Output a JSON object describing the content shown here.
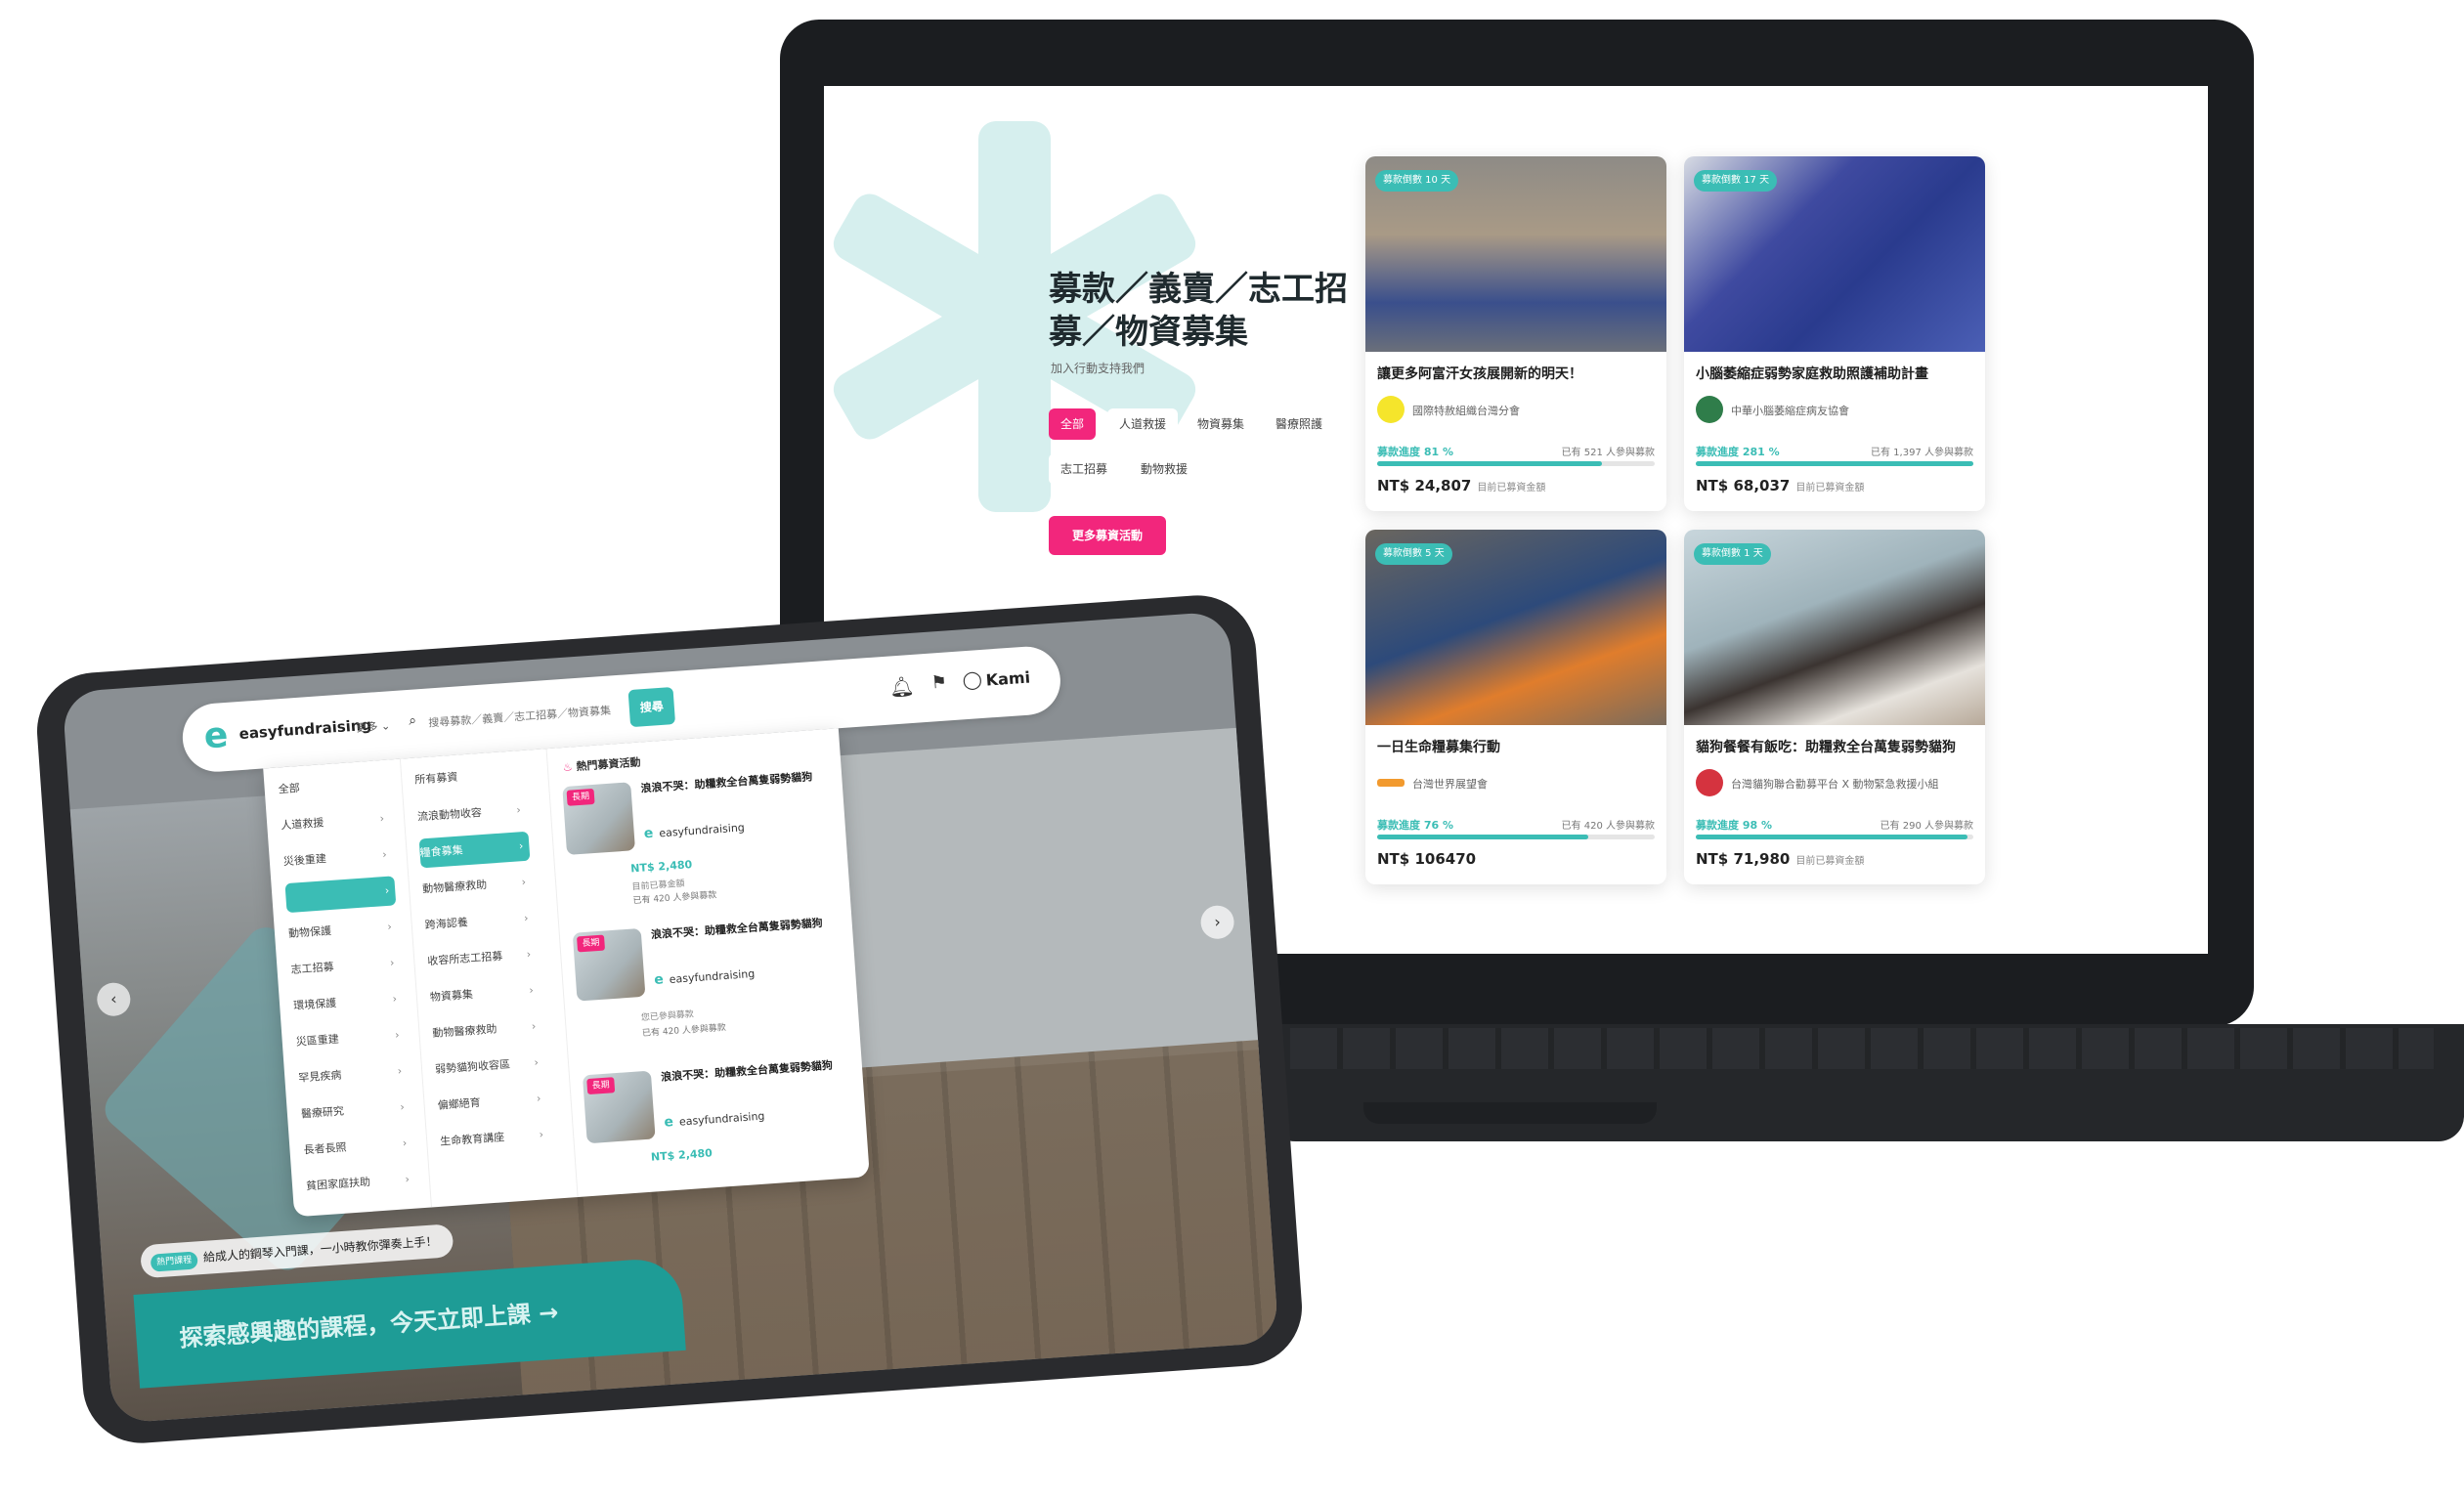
{
  "colors": {
    "teal": "#3bbdb5",
    "pink": "#f2267c"
  },
  "laptop": {
    "hero": {
      "title": "募款／義賣／志工招募／物資募集",
      "subtitle": "加入行動支持我們",
      "chips": [
        "全部",
        "人道救援",
        "物資募集",
        "醫療照護",
        "志工招募",
        "動物救援"
      ],
      "active_chip": "全部",
      "more_button": "更多募資活動"
    },
    "cards": [
      {
        "badge": "募款倒數 10 天",
        "title": "讓更多阿富汗女孩展開新的明天！",
        "org": "國際特赦組織台灣分會",
        "progress_label": "募款進度 81 %",
        "progress": 0.81,
        "count": "已有 521 人參與募款",
        "amount": "NT$ 24,807",
        "amount_label": "目前已募資金額"
      },
      {
        "badge": "募款倒數 17 天",
        "title": "小腦萎縮症弱勢家庭救助照護補助計畫",
        "org": "中華小腦萎縮症病友協會",
        "progress_label": "募款進度 281 %",
        "progress": 1.0,
        "count": "已有 1,397 人參與募款",
        "amount": "NT$ 68,037",
        "amount_label": "目前已募資金額"
      },
      {
        "badge": "募款倒數 5 天",
        "title": "一日生命糧募集行動",
        "org": "台灣世界展望會",
        "progress_label": "募款進度 76 %",
        "progress": 0.76,
        "count": "已有 420 人參與募款",
        "amount": "NT$ 106470",
        "amount_label": ""
      },
      {
        "badge": "募款倒數 1 天",
        "title": "貓狗餐餐有飯吃：助糧救全台萬隻弱勢貓狗",
        "org": "台灣貓狗聯合勸募平台 X 動物緊急救援小組",
        "progress_label": "募款進度 98 %",
        "progress": 0.98,
        "count": "已有 290 人參與募款",
        "amount": "NT$ 71,980",
        "amount_label": "目前已募資金額"
      }
    ]
  },
  "tablet": {
    "nav": {
      "logo": "easyfundraising",
      "more": "更多 ⌄",
      "search_placeholder": "搜尋募款／義賣／志工招募／物資募集",
      "search_button": "搜尋",
      "user": "Kami"
    },
    "mega": {
      "col1": [
        "全部",
        "人道救援",
        "災後重建",
        "",
        "動物保護",
        "志工招募",
        "環境保護",
        "災區重建",
        "罕見疾病",
        "醫療研究",
        "長者長照",
        "貧困家庭扶助"
      ],
      "col1_selected": 3,
      "col2_title": "所有募資",
      "col2": [
        "流浪動物收容",
        "糧食募集",
        "動物醫療救助",
        "跨海認養",
        "收容所志工招募",
        "物資募集",
        "動物醫療救助",
        "弱勢貓狗收容區",
        "偏鄉絕育",
        "生命教育講座"
      ],
      "col2_selected": 1,
      "hot_title": "熱門募資活動",
      "hot": [
        {
          "tag": "長期",
          "name": "浪浪不哭：助糧救全台萬隻弱勢貓狗",
          "org": "easyfundraising",
          "amount": "NT$ 2,480",
          "label": "目前已募金額",
          "count": "已有 420 人參與募款"
        },
        {
          "tag": "長期",
          "name": "浪浪不哭：助糧救全台萬隻弱勢貓狗",
          "org": "easyfundraising",
          "amount": "",
          "label": "您已參與募款",
          "count": "已有 420 人參與募款"
        },
        {
          "tag": "長期",
          "name": "浪浪不哭：助糧救全台萬隻弱勢貓狗",
          "org": "easyfundraising",
          "amount": "NT$ 2,480",
          "label": "",
          "count": ""
        }
      ]
    },
    "tip_tag": "熱門課程",
    "tip_text": "給成人的鋼琴入門課，一小時教你彈奏上手！",
    "cta": "探索感興趣的課程，今天立即上課 →"
  }
}
